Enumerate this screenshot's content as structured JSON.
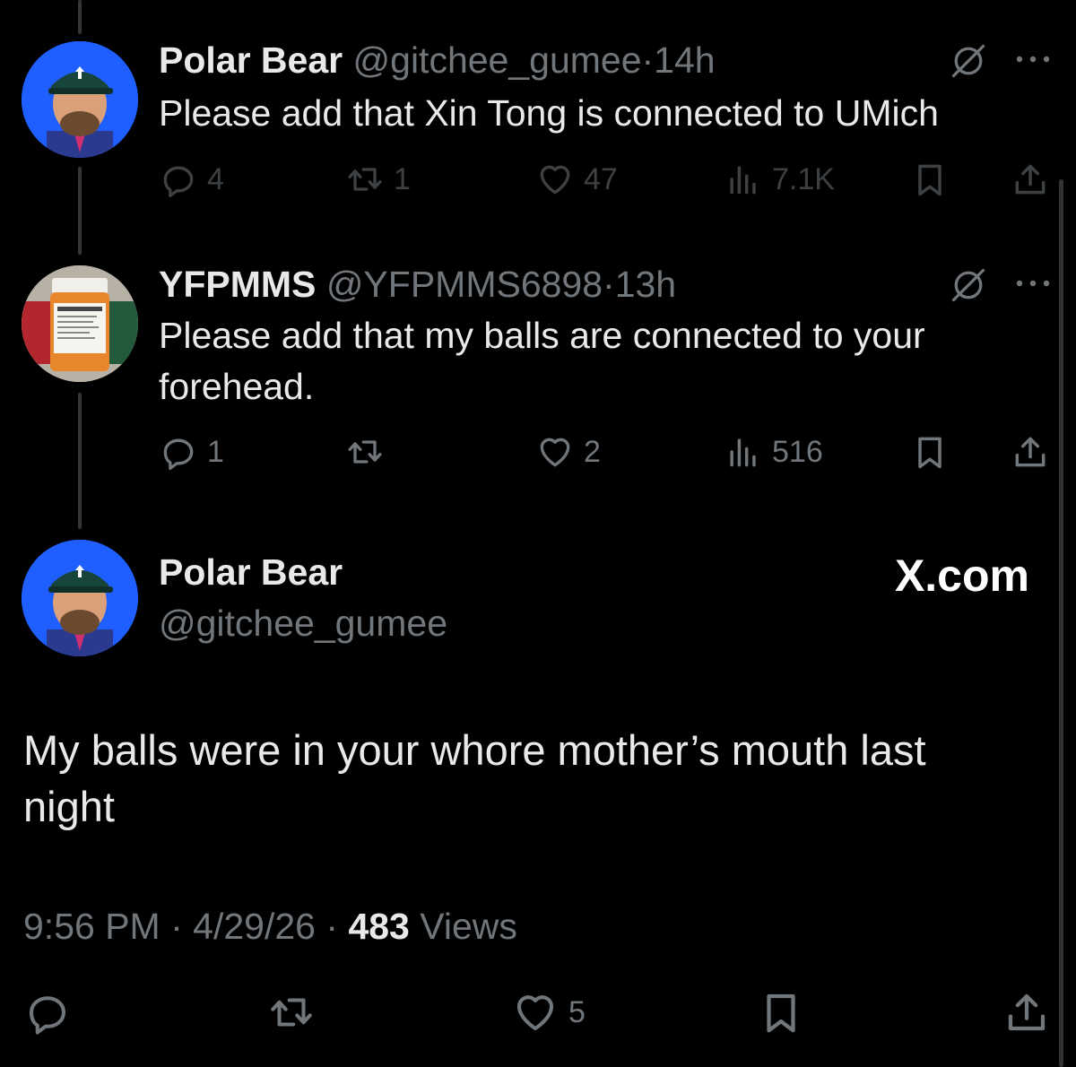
{
  "tweets": [
    {
      "name": "Polar Bear",
      "handle": "@gitchee_gumee",
      "separator": "·",
      "time": "14h",
      "text": "Please add that Xin Tong is connected to UMich",
      "replies": "4",
      "reposts": "1",
      "likes": "47",
      "views": "7.1K"
    },
    {
      "name": "YFPMMS",
      "handle": "@YFPMMS6898",
      "separator": "·",
      "time": "13h",
      "text": "Please add that my balls are connected to your forehead.",
      "replies": "1",
      "reposts": "",
      "likes": "2",
      "views": "516"
    }
  ],
  "main": {
    "name": "Polar Bear",
    "handle": "@gitchee_gumee",
    "watermark": "X.com",
    "text": "My balls were in your whore mother’s mouth last night",
    "time": "9:56 PM",
    "sep1": "·",
    "date": "4/29/26",
    "sep2": "·",
    "views_count": "483",
    "views_label": "Views",
    "likes": "5"
  },
  "colors": {
    "background": "#000000",
    "text": "#e7e9ea",
    "muted": "#71767b",
    "avatar_blue": "#1f5fff",
    "hat_green": "#18453b"
  },
  "icons": [
    "reply-icon",
    "repost-icon",
    "like-icon",
    "views-icon",
    "bookmark-icon",
    "share-icon",
    "grok-icon",
    "more-icon"
  ]
}
